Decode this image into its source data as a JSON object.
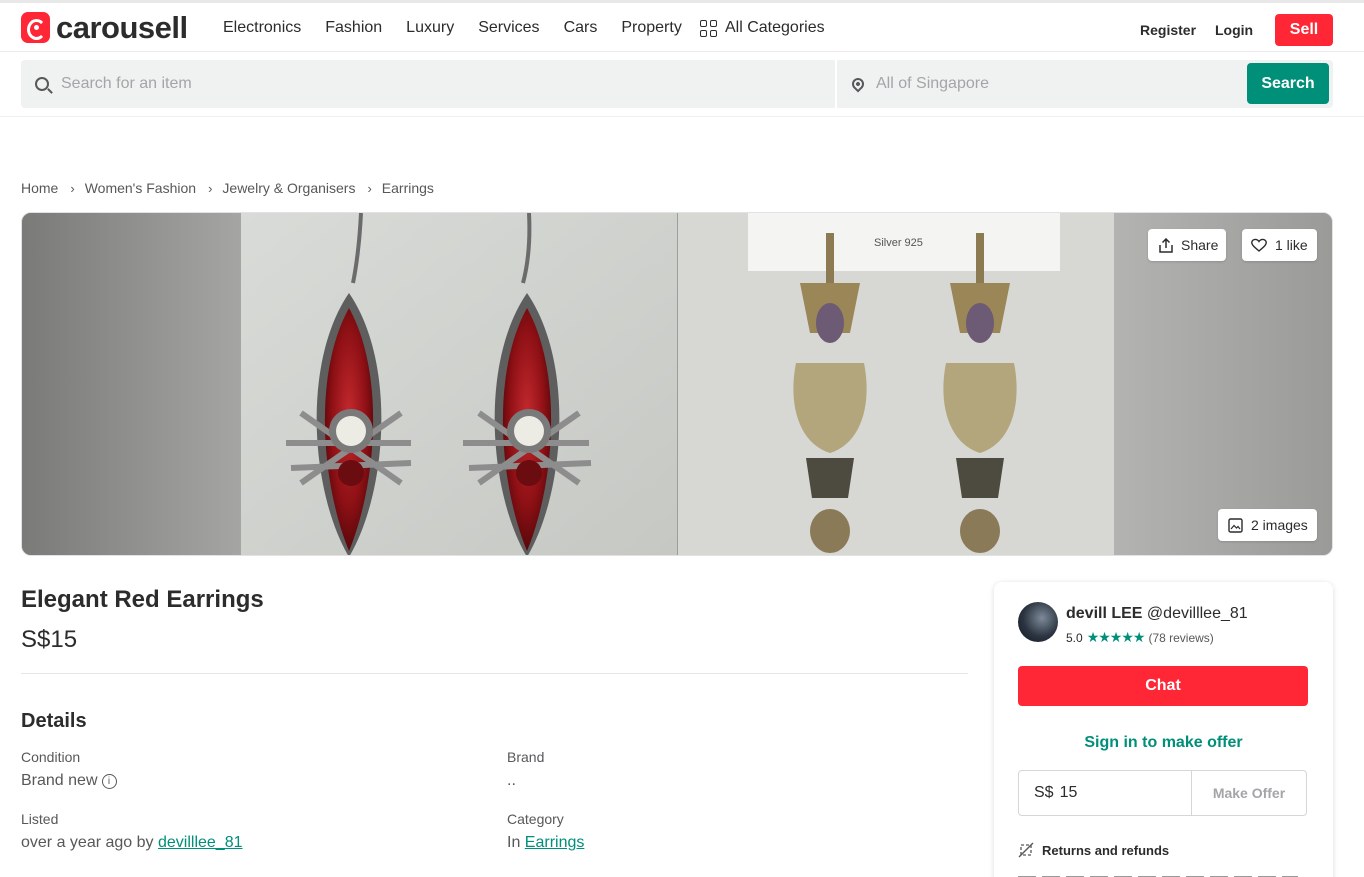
{
  "header": {
    "logo_text": "carousell",
    "nav": [
      "Electronics",
      "Fashion",
      "Luxury",
      "Services",
      "Cars",
      "Property"
    ],
    "all_categories": "All Categories",
    "register": "Register",
    "login": "Login",
    "sell": "Sell",
    "brand_color": "#ff2636",
    "accent_color": "#008f79"
  },
  "search": {
    "placeholder": "Search for an item",
    "location_placeholder": "All of Singapore",
    "button": "Search"
  },
  "breadcrumb": [
    "Home",
    "Women's Fashion",
    "Jewelry & Organisers",
    "Earrings"
  ],
  "gallery": {
    "share": "Share",
    "likes": "1 like",
    "image_count": "2 images",
    "tag_text": "Silver 925"
  },
  "listing": {
    "title": "Elegant Red Earrings",
    "price": "S$15",
    "details_heading": "Details",
    "condition_label": "Condition",
    "condition_value": "Brand new",
    "brand_label": "Brand",
    "brand_value": "..",
    "listed_label": "Listed",
    "listed_prefix": "over a year ago by",
    "listed_user": "devilllee_81",
    "category_label": "Category",
    "category_prefix": "In",
    "category_value": "Earrings"
  },
  "seller": {
    "name": "devill LEE",
    "handle": "@devilllee_81",
    "rating": "5.0",
    "stars": "★★★★★",
    "reviews": "(78 reviews)",
    "chat": "Chat",
    "sign_in_offer": "Sign in to make offer",
    "currency": "S$",
    "offer_value": "15",
    "make_offer": "Make Offer",
    "returns": "Returns and refunds"
  }
}
